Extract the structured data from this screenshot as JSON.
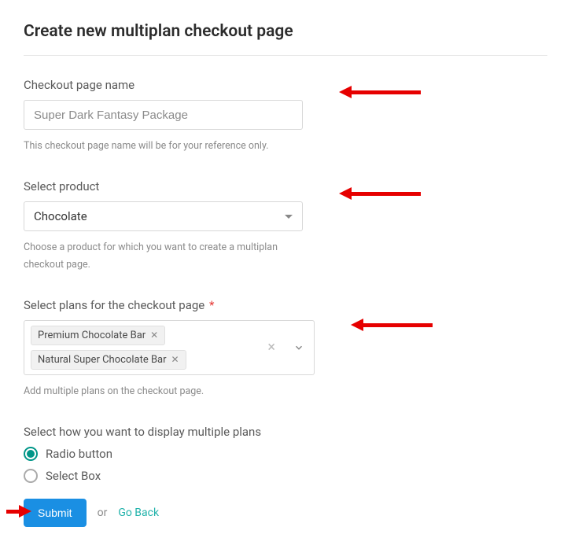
{
  "page": {
    "title": "Create new multiplan checkout page"
  },
  "fields": {
    "name": {
      "label": "Checkout page name",
      "value": "Super Dark Fantasy Package",
      "helper": "This checkout page name will be for your reference only."
    },
    "product": {
      "label": "Select product",
      "value": "Chocolate",
      "helper": "Choose a product for which you want to create a multiplan checkout page."
    },
    "plans": {
      "label": "Select plans for the checkout page",
      "required_marker": "*",
      "selected": [
        "Premium Chocolate Bar",
        "Natural Super Chocolate Bar"
      ],
      "helper": "Add multiple plans on the checkout page."
    },
    "display": {
      "label": "Select how you want to display multiple plans",
      "options": [
        {
          "label": "Radio button",
          "checked": true
        },
        {
          "label": "Select Box",
          "checked": false
        }
      ]
    }
  },
  "actions": {
    "submit": "Submit",
    "or": "or",
    "go_back": "Go Back"
  }
}
